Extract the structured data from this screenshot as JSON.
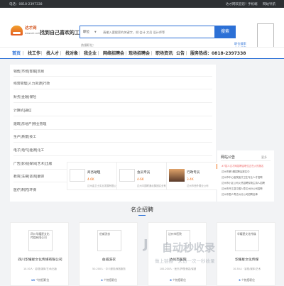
{
  "topbar": {
    "hotline": "电话：0818-2397338",
    "right_items": [
      "达才网欢迎您！",
      "手机端",
      "网站导航"
    ]
  },
  "header": {
    "brand": "达才网",
    "domain": "dzwork.net",
    "slogan": "找到自己喜欢的工作",
    "search": {
      "type_label": "职位",
      "placeholder": "请输入要搜索的关键字，如:会计 文员 设计师等",
      "button_label": "搜索"
    },
    "hot_search_label": "热搜职位：",
    "login_link": "职位搜索",
    "register_link": "企业搜索"
  },
  "nav": {
    "items": [
      "首页",
      "找工作",
      "找人才",
      "找对象",
      "我企业",
      "网络招聘会",
      "现场招聘会",
      "职场资讯",
      "公告",
      "服务热线：0818-2397338"
    ],
    "active_index": 0,
    "accent_color": "#2c70d6"
  },
  "categories": [
    "销售|市场|客服|贸易",
    "经营管理|人力资源|行政",
    "财务|金融|保险",
    "计算机|通信",
    "建筑|房地产|物业管理",
    "生产|质量|技工",
    "电子|电气|能源|化工",
    "广告|影视|媒体|艺术|出版",
    "教育|法律|咨询|翻译",
    "医疗|制药|环保"
  ],
  "notices": {
    "title": "网站公告",
    "more": "更多",
    "items": [
      "#7招人达才网招聘会职位正在火热报名",
      "达州市第3期招聘会报名中",
      "达州市中心医院医疗卫生专业人才招聘",
      "达州市小区公司火热招聘现场主持人招聘",
      "达州市开江县中国人寿达州分公司招聘",
      "达州中国人寿达州分公司招聘启事"
    ]
  },
  "featured_jobs": [
    {
      "title": "商务助理",
      "salary": "4-6K",
      "company": "达州金卫士实业发展有限公司",
      "tag": "急聘"
    },
    {
      "title": "会员专员",
      "salary": "4-6K",
      "company": "达州中国联通北集团实业有限公司",
      "tag": "急聘"
    },
    {
      "title": "行政专员",
      "salary": "3-4K",
      "company": "达州市西外置业公司",
      "tag": "急聘"
    }
  ],
  "section_title": "名企招聘",
  "companies": [
    {
      "logo_text": "四川华耀星文化传媒有限公司",
      "name": "四川华耀星文化传媒有限公司",
      "meta": "10-50人 · 影视/媒体/艺术/出版",
      "count": "15",
      "count_suffix": "个热招职位"
    },
    {
      "logo_text": "伯威洗衣",
      "name": "伯威洗衣",
      "meta": "50-200人 · 中介服务/家政服务",
      "count": "4",
      "count_suffix": "个热招职位"
    },
    {
      "logo_text": "达州市医院",
      "name": "达州市医院",
      "meta": "100-200人 · 医疗/护理/美容/保健",
      "count": "6",
      "count_suffix": "个热招职位"
    },
    {
      "logo_text": "华耀星文化传媒",
      "name": "华耀星文化传媒",
      "meta": "10-50人 · 影视/媒体/艺术",
      "count": "3",
      "count_suffix": "个热招职位"
    }
  ],
  "watermark": {
    "text": "自动秒收录",
    "sub": "做上链接一来访一次一秒收录"
  }
}
